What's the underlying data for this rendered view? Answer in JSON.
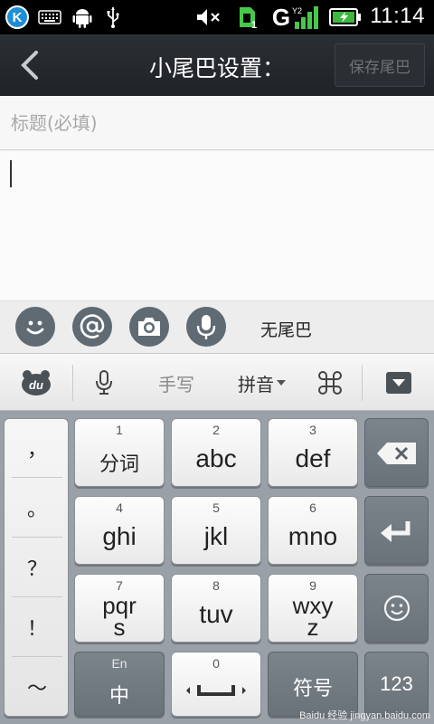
{
  "status_bar": {
    "k_icon_letter": "K",
    "sim_badge": "1",
    "network_type": "G",
    "time": "11:14",
    "icons": [
      "k-app-icon",
      "keyboard-icon",
      "android-icon",
      "usb-icon",
      "mute-icon",
      "sim-icon",
      "signal-icon",
      "battery-charging-icon"
    ]
  },
  "titlebar": {
    "title": "小尾巴设置：",
    "save_label": "保存尾巴"
  },
  "form": {
    "title_placeholder": "标题(必填)",
    "title_value": "",
    "body_value": ""
  },
  "toolbar": {
    "tail_label": "无尾巴",
    "buttons": [
      "smiley-icon",
      "at-icon",
      "camera-icon",
      "microphone-icon"
    ]
  },
  "ime_bar": {
    "logo": "du",
    "handwrite": "手写",
    "pinyin": "拼音"
  },
  "keyboard": {
    "punct": [
      "，",
      "。",
      "？",
      "！",
      "～"
    ],
    "keys": [
      {
        "num": "1",
        "label": "分词"
      },
      {
        "num": "2",
        "label": "abc"
      },
      {
        "num": "3",
        "label": "def"
      },
      {
        "num": "4",
        "label": "ghi"
      },
      {
        "num": "5",
        "label": "jkl"
      },
      {
        "num": "6",
        "label": "mno"
      },
      {
        "num": "7",
        "label": "pqrs"
      },
      {
        "num": "8",
        "label": "tuv"
      },
      {
        "num": "9",
        "label": "wxyz"
      }
    ],
    "lang_top": "En",
    "lang_main": "中",
    "space_num": "0",
    "symbol": "符号",
    "num_switch": "123"
  },
  "watermark": {
    "text": "Baidu 经验",
    "url": "jingyan.baidu.com"
  },
  "colors": {
    "statusbar": "#000000",
    "titlebar": "#24292d",
    "toolbar_button": "#5f6a73",
    "keyboard_bg": "#9aa0a7",
    "k_icon": "#1e8fd6",
    "battery": "#3cb83c"
  }
}
